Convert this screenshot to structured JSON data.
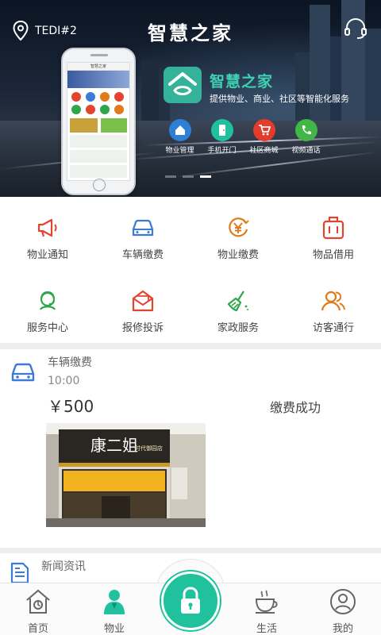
{
  "header": {
    "location": "TEDI#2",
    "title": "智慧之家"
  },
  "banner": {
    "brand_name": "智慧之家",
    "slogan": "提供物业、商业、社区等智能化服务",
    "phone_title": "智慧之家",
    "features": [
      {
        "label": "物业管理",
        "icon": "house-icon",
        "color": "#2e7fd6"
      },
      {
        "label": "手机开门",
        "icon": "door-icon",
        "color": "#1fc29c"
      },
      {
        "label": "社区商城",
        "icon": "cart-icon",
        "color": "#e53b2c"
      },
      {
        "label": "视频通话",
        "icon": "phone-icon",
        "color": "#43b648"
      }
    ],
    "active_slide": 3,
    "slide_count": 3
  },
  "services": [
    {
      "label": "物业通知",
      "icon": "megaphone-icon",
      "color": "#e2452e"
    },
    {
      "label": "车辆缴费",
      "icon": "car-icon",
      "color": "#3a7ad8"
    },
    {
      "label": "物业缴费",
      "icon": "yen-coin-icon",
      "color": "#e07a1a"
    },
    {
      "label": "物品借用",
      "icon": "luggage-icon",
      "color": "#e2452e"
    },
    {
      "label": "服务中心",
      "icon": "service-headset-icon",
      "color": "#2fa64a"
    },
    {
      "label": "报修投诉",
      "icon": "envelope-icon",
      "color": "#e2452e"
    },
    {
      "label": "家政服务",
      "icon": "broom-icon",
      "color": "#2fa64a"
    },
    {
      "label": "访客通行",
      "icon": "visitors-icon",
      "color": "#e07a1a"
    }
  ],
  "message_card": {
    "title": "车辆缴费",
    "time": "10:00",
    "amount": "￥500",
    "status": "缴费成功",
    "store_sign": "康二姐",
    "store_sub": "时代御园店"
  },
  "news": {
    "title": "新闻资讯"
  },
  "tabbar": {
    "items": [
      {
        "label": "首页",
        "icon": "home-icon"
      },
      {
        "label": "物业",
        "icon": "person-icon"
      },
      {
        "label": "",
        "icon": "lock-icon"
      },
      {
        "label": "生活",
        "icon": "coffee-cup-icon"
      },
      {
        "label": "我的",
        "icon": "profile-icon"
      }
    ],
    "active_index": 1,
    "accent": "#1fc29c"
  }
}
